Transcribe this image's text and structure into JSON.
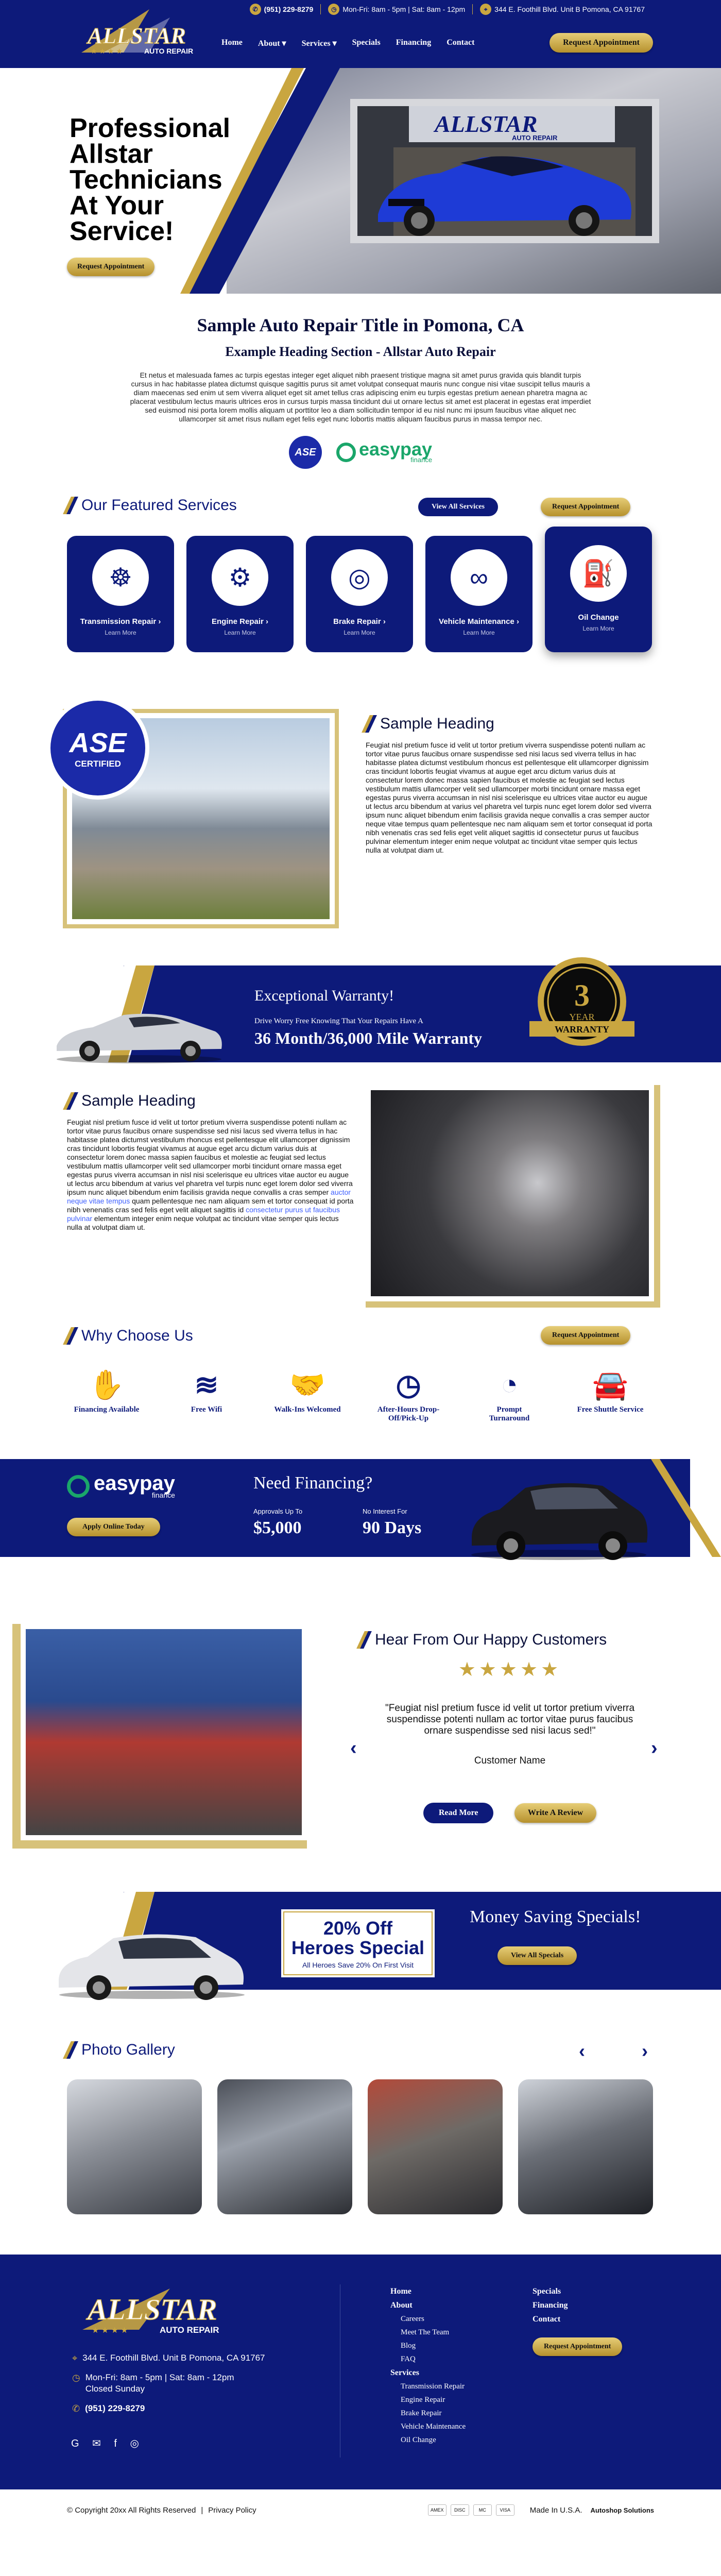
{
  "topbar": {
    "phone": "(951) 229-8279",
    "hours": "Mon-Fri: 8am - 5pm | Sat: 8am - 12pm",
    "address": "344 E. Foothill Blvd. Unit B Pomona, CA 91767"
  },
  "logo": {
    "brand": "ALLSTAR",
    "stars": "★ ★ ★ ★",
    "sub": "AUTO REPAIR"
  },
  "nav": {
    "items": [
      "Home",
      "About ▾",
      "Services ▾",
      "Specials",
      "Financing",
      "Contact"
    ],
    "cta": "Request Appointment"
  },
  "hero": {
    "title": "Professional Allstar Technicians At Your Service!",
    "cta": "Request Appointment",
    "sign": "ALLSTAR",
    "sign_sub": "AUTO REPAIR"
  },
  "intro": {
    "title": "Sample  Auto Repair Title in Pomona, CA",
    "subtitle": "Example Heading Section - Allstar Auto Repair",
    "body": "Et netus et malesuada fames ac turpis egestas integer eget aliquet nibh praesent tristique magna sit amet purus gravida quis blandit turpis cursus in hac habitasse platea dictumst quisque sagittis purus sit amet volutpat consequat mauris nunc congue nisi vitae suscipit tellus mauris a diam maecenas sed enim ut sem viverra aliquet eget sit amet tellus cras adipiscing enim eu turpis egestas pretium aenean pharetra magna ac placerat vestibulum lectus mauris ultrices eros in cursus turpis massa tincidunt dui ut ornare lectus sit amet est placerat in egestas erat imperdiet sed euismod nisi porta lorem mollis aliquam ut porttitor leo a diam sollicitudin tempor id eu nisl nunc mi ipsum faucibus vitae aliquet nec ullamcorper sit amet risus nullam eget felis eget nunc lobortis mattis aliquam faucibus purus in massa tempor nec.",
    "badge_ase": "ASE",
    "badge_easypay": "easypay",
    "badge_easypay_sub": "finance"
  },
  "services": {
    "title": "Our Featured Services",
    "view_all": "View All Services",
    "cta": "Request Appointment",
    "items": [
      {
        "name": "Transmission Repair ›",
        "link": "Learn More",
        "icon": "steering-wheel-icon",
        "glyph": "☸"
      },
      {
        "name": "Engine Repair ›",
        "link": "Learn More",
        "icon": "engine-icon",
        "glyph": "⚙"
      },
      {
        "name": "Brake Repair ›",
        "link": "Learn More",
        "icon": "brake-icon",
        "glyph": "◎"
      },
      {
        "name": "Vehicle Maintenance ›",
        "link": "Learn More",
        "icon": "belt-icon",
        "glyph": "∞"
      },
      {
        "name": "Oil Change",
        "link": "Learn More",
        "icon": "oil-icon",
        "glyph": "⛽"
      }
    ]
  },
  "sample1": {
    "badge_top": "ASE",
    "badge_bottom": "CERTIFIED",
    "title": "Sample Heading",
    "body": "Feugiat nisl pretium fusce id velit ut tortor pretium viverra suspendisse potenti nullam ac tortor vitae purus faucibus ornare suspendisse sed nisi lacus sed viverra tellus in hac habitasse platea dictumst vestibulum rhoncus est pellentesque elit ullamcorper dignissim cras tincidunt lobortis feugiat vivamus at augue eget arcu dictum varius duis at consectetur lorem donec massa sapien faucibus et molestie ac feugiat sed lectus vestibulum mattis ullamcorper velit sed ullamcorper morbi tincidunt ornare massa eget egestas purus viverra accumsan in nisl nisi scelerisque eu ultrices vitae auctor eu augue ut lectus arcu bibendum at varius vel pharetra vel turpis nunc eget lorem dolor sed viverra ipsum nunc aliquet bibendum enim facilisis gravida neque convallis a cras semper auctor neque vitae tempus quam pellentesque nec nam aliquam sem et tortor consequat id porta nibh venenatis cras sed felis eget velit aliquet sagittis id consectetur purus ut faucibus pulvinar elementum integer enim neque volutpat ac tincidunt vitae semper quis lectus nulla at volutpat diam ut."
  },
  "warranty": {
    "title": "Exceptional Warranty!",
    "sub": "Drive Worry Free Knowing That Your Repairs Have A",
    "value": "36 Month/36,000 Mile Warranty",
    "seal_num": "3",
    "seal_year": "YEAR",
    "seal_label": "WARRANTY"
  },
  "sample2": {
    "title": "Sample Heading",
    "body_a": "Feugiat nisl pretium fusce id velit ut tortor pretium viverra suspendisse potenti nullam ac tortor vitae purus faucibus ornare suspendisse sed nisi lacus sed viverra tellus in hac habitasse platea dictumst vestibulum rhoncus est pellentesque elit ullamcorper dignissim cras tincidunt lobortis feugiat vivamus at augue eget arcu dictum varius duis at consectetur lorem donec massa sapien faucibus et molestie ac feugiat sed lectus vestibulum mattis ullamcorper velit sed ullamcorper morbi tincidunt ornare massa eget egestas purus viverra accumsan in nisl nisi scelerisque eu ultrices vitae auctor eu augue ut lectus arcu bibendum at varius vel pharetra vel turpis nunc eget lorem dolor sed viverra ipsum nunc aliquet bibendum enim facilisis gravida neque convallis a cras semper ",
    "link_a": "auctor neque vitae tempus",
    "body_b": " quam pellentesque nec nam aliquam sem et tortor consequat id porta nibh venenatis cras sed felis eget velit aliquet sagittis id ",
    "link_b": "consectetur purus ut faucibus pulvinar",
    "body_c": " elementum integer enim neque volutpat ac tincidunt vitae semper quis lectus nulla at volutpat diam ut."
  },
  "why": {
    "title": "Why Choose Us",
    "cta": "Request Appointment",
    "items": [
      {
        "label": "Financing Available",
        "icon": "financing-icon",
        "glyph": "✋"
      },
      {
        "label": "Free Wifi",
        "icon": "wifi-icon",
        "glyph": "≋"
      },
      {
        "label": "Walk-Ins Welcomed",
        "icon": "handshake-icon",
        "glyph": "🤝"
      },
      {
        "label": "After-Hours Drop-Off/Pick-Up",
        "icon": "clock-icon",
        "glyph": "◷"
      },
      {
        "label": "Prompt Turnaround",
        "icon": "speedometer-icon",
        "glyph": "◔"
      },
      {
        "label": "Free Shuttle Service",
        "icon": "car-icon",
        "glyph": "🚘"
      }
    ]
  },
  "financing": {
    "logo": "easypay",
    "logo_sub": "finance",
    "cta": "Apply Online Today",
    "title": "Need Financing?",
    "col1_label": "Approvals Up To",
    "col1_value": "$5,000",
    "col2_label": "No Interest For",
    "col2_value": "90 Days"
  },
  "testimonials": {
    "title": "Hear From Our Happy Customers",
    "stars": "★★★★★",
    "quote": "\"Feugiat nisl pretium fusce id velit ut tortor pretium viverra suspendisse potenti nullam ac tortor vitae purus faucibus ornare suspendisse sed nisi lacus sed!\"",
    "name": "Customer Name",
    "read_more": "Read More",
    "write_review": "Write A Review",
    "prev": "‹",
    "next": "›"
  },
  "specials": {
    "pct": "20% Off",
    "name": "Heroes Special",
    "desc": "All Heroes Save 20% On First Visit",
    "title": "Money Saving Specials!",
    "cta": "View All Specials"
  },
  "gallery": {
    "title": "Photo Gallery",
    "prev": "‹",
    "next": "›"
  },
  "footer": {
    "address": "344 E. Foothill Blvd. Unit B Pomona, CA 91767",
    "hours_1": "Mon-Fri: 8am - 5pm | Sat: 8am - 12pm",
    "hours_2": "Closed Sunday",
    "phone": "(951) 229-8279",
    "social": "G  ✉  f  ◎",
    "col1": {
      "home": "Home",
      "about": "About",
      "about_items": [
        "Careers",
        "Meet The Team",
        "Blog",
        "FAQ"
      ],
      "services": "Services",
      "services_items": [
        "Transmission Repair",
        "Engine Repair",
        "Brake Repair",
        "Vehicle Maintenance",
        "Oil Change"
      ]
    },
    "col2": {
      "items": [
        "Specials",
        "Financing",
        "Contact"
      ],
      "cta": "Request Appointment"
    }
  },
  "bottom": {
    "copyright": "© Copyright 20xx All Rights Reserved",
    "sep": "|",
    "privacy": "Privacy Policy",
    "pay": [
      "AMEX",
      "DISC",
      "MC",
      "VISA"
    ],
    "made": "Made In U.S.A.",
    "brand": "Autoshop Solutions"
  },
  "colors": {
    "navy": "#0d1a7a",
    "gold": "#c9a640"
  }
}
